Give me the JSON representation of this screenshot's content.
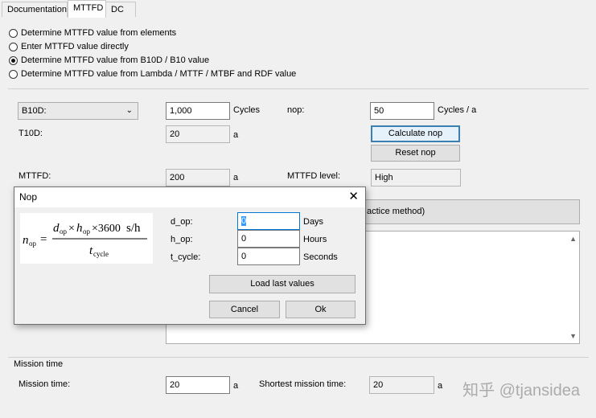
{
  "tabs": [
    {
      "label": "Documentation"
    },
    {
      "label": "MTTFD"
    },
    {
      "label": "DC"
    }
  ],
  "radio_options": [
    {
      "label": "Determine MTTFD value from elements",
      "selected": false
    },
    {
      "label": "Enter MTTFD value directly",
      "selected": false
    },
    {
      "label": "Determine MTTFD value from B10D / B10 value",
      "selected": true
    },
    {
      "label": "Determine MTTFD value from Lambda / MTTF / MTBF and RDF value",
      "selected": false
    }
  ],
  "main": {
    "b10d_dropdown": "B10D:",
    "b10d_value": "1,000",
    "b10d_unit": "Cycles",
    "nop_label": "nop:",
    "nop_value": "50",
    "nop_unit": "Cycles / a",
    "t10d_label": "T10D:",
    "t10d_value": "20",
    "t10d_unit": "a",
    "calculate_nop_label": "Calculate nop",
    "reset_nop_label": "Reset nop",
    "mttfd_label": "MTTFD:",
    "mttfd_value": "200",
    "mttfd_unit": "a",
    "mttfd_level_label": "MTTFD level:",
    "mttfd_level_value": "High",
    "partial_button_label": "actice method)"
  },
  "mission": {
    "group_label": "Mission time",
    "mission_time_label": "Mission time:",
    "mission_time_value": "20",
    "mission_time_unit": "a",
    "shortest_label": "Shortest mission time:",
    "shortest_value": "20",
    "shortest_unit": "a"
  },
  "dialog": {
    "title": "Nop",
    "close": "✕",
    "fields": [
      {
        "label": "d_op:",
        "value": "0",
        "unit": "Days"
      },
      {
        "label": "h_op:",
        "value": "0",
        "unit": "Hours"
      },
      {
        "label": "t_cycle:",
        "value": "0",
        "unit": "Seconds"
      }
    ],
    "load_last_values_label": "Load last values",
    "cancel_label": "Cancel",
    "ok_label": "Ok"
  },
  "watermark": "知乎 @tjansidea"
}
